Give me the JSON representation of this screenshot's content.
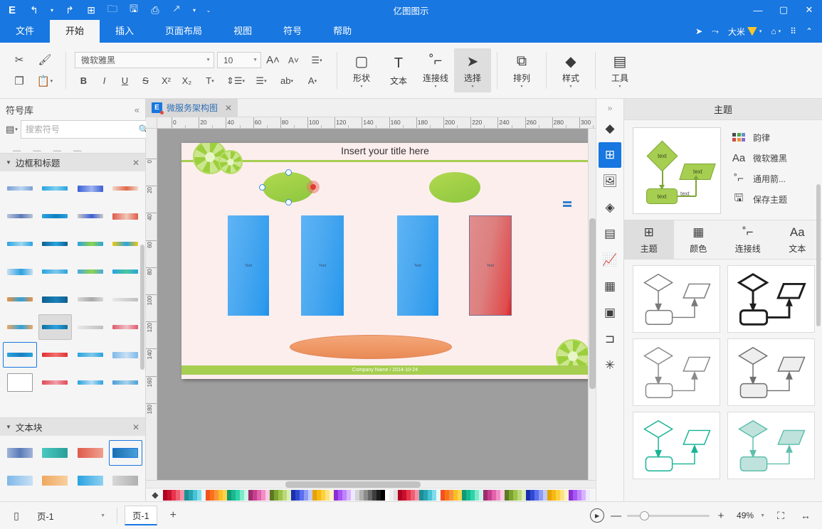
{
  "titlebar": {
    "app_title": "亿图图示",
    "logo": "E",
    "quick_access": [
      {
        "name": "undo-button",
        "glyph": "↰",
        "has_caret": true
      },
      {
        "name": "redo-button",
        "glyph": "↳",
        "has_caret": false
      },
      {
        "name": "new-button",
        "glyph": "⊞",
        "has_caret": false
      },
      {
        "name": "open-button",
        "glyph": "🗀",
        "has_caret": false
      },
      {
        "name": "save-button",
        "glyph": "🖫",
        "has_caret": false
      },
      {
        "name": "print-button",
        "glyph": "⎙",
        "has_caret": false
      },
      {
        "name": "export-button",
        "glyph": "⇱",
        "has_caret": true
      },
      {
        "name": "more-button",
        "glyph": "⌄",
        "has_caret": false
      }
    ],
    "window_controls": {
      "minimize": "—",
      "maximize": "▢",
      "close": "✕"
    }
  },
  "menubar": {
    "tabs": [
      {
        "label": "文件",
        "active": false
      },
      {
        "label": "开始",
        "active": true
      },
      {
        "label": "插入",
        "active": false
      },
      {
        "label": "页面布局",
        "active": false
      },
      {
        "label": "视图",
        "active": false
      },
      {
        "label": "符号",
        "active": false
      },
      {
        "label": "帮助",
        "active": false
      }
    ],
    "right_items": [
      {
        "name": "send-icon",
        "glyph": "➤",
        "label": ""
      },
      {
        "name": "share-icon",
        "glyph": "⤳",
        "label": ""
      },
      {
        "name": "user-account",
        "glyph": "",
        "label": "大米",
        "vip": true
      },
      {
        "name": "skin-icon",
        "glyph": "⌂",
        "label": ""
      },
      {
        "name": "apps-icon",
        "glyph": "⠿",
        "label": ""
      },
      {
        "name": "collapse-ribbon-icon",
        "glyph": "⌃",
        "label": ""
      }
    ]
  },
  "ribbon": {
    "clipboard": [
      {
        "name": "cut-button",
        "glyph": "✂"
      },
      {
        "name": "format-painter-button",
        "glyph": "🖌"
      },
      {
        "name": "copy-button",
        "glyph": "❐"
      },
      {
        "name": "paste-button",
        "glyph": "📋"
      }
    ],
    "font": {
      "family": "微软雅黑",
      "size": "10",
      "grow_label": "A",
      "shrink_label": "A"
    },
    "format_buttons": [
      {
        "name": "bold-button",
        "glyph": "B"
      },
      {
        "name": "italic-button",
        "glyph": "I"
      },
      {
        "name": "underline-button",
        "glyph": "U"
      },
      {
        "name": "strikethrough-button",
        "glyph": "S"
      },
      {
        "name": "superscript-button",
        "glyph": "X²"
      },
      {
        "name": "subscript-button",
        "glyph": "X₂"
      },
      {
        "name": "text-color-button",
        "glyph": "T"
      },
      {
        "name": "line-spacing-button",
        "glyph": "↕☰"
      },
      {
        "name": "bullet-list-button",
        "glyph": "☰"
      },
      {
        "name": "text-case-button",
        "glyph": "ab"
      },
      {
        "name": "clear-format-button",
        "glyph": "A"
      }
    ],
    "tools": [
      {
        "name": "shape-tool",
        "label": "形状",
        "glyph": "▢",
        "active": false,
        "caret": true
      },
      {
        "name": "text-tool",
        "label": "文本",
        "glyph": "T",
        "active": false,
        "caret": false
      },
      {
        "name": "connector-tool",
        "label": "连接线",
        "glyph": "⌐",
        "active": false,
        "caret": true
      },
      {
        "name": "select-tool",
        "label": "选择",
        "glyph": "➤",
        "active": true,
        "caret": true
      }
    ],
    "tools2": [
      {
        "name": "arrange-tool",
        "label": "排列",
        "glyph": "⧉",
        "active": false,
        "caret": true
      },
      {
        "name": "style-tool",
        "label": "样式",
        "glyph": "◆",
        "active": false,
        "caret": true
      },
      {
        "name": "utility-tool",
        "label": "工具",
        "glyph": "▤",
        "active": false,
        "caret": true
      }
    ]
  },
  "left_panel": {
    "title": "符号库",
    "collapse_glyph": "«",
    "search_placeholder": "搜索符号",
    "search_value": "",
    "search_icon": "🔍",
    "library_icon": "▤",
    "nav_up": "⌃",
    "nav_down": "⌄",
    "sections": [
      {
        "name": "section-borders-titles",
        "label": "边框和标题",
        "expanded": true
      },
      {
        "name": "section-text-blocks",
        "label": "文本块",
        "expanded": true
      }
    ]
  },
  "canvas": {
    "doc_tab": {
      "label": "微服务架构图",
      "close_glyph": "✕",
      "icon_letter": "E"
    },
    "ruler_ticks": [
      "0",
      "20",
      "40",
      "60",
      "80",
      "100",
      "120",
      "140",
      "160",
      "180",
      "200",
      "220",
      "240",
      "260",
      "280",
      "300"
    ],
    "vruler_ticks": [
      "0",
      "20",
      "40",
      "60",
      "80",
      "100",
      "120",
      "140",
      "160",
      "180"
    ],
    "page": {
      "title": "Insert your title here",
      "footer": "Company Name / 2014-10-24",
      "shapes": [
        {
          "name": "rect-1",
          "label": "Text",
          "color": "blue"
        },
        {
          "name": "rect-2",
          "label": "Text",
          "color": "blue"
        },
        {
          "name": "rect-3",
          "label": "Text",
          "color": "blue"
        },
        {
          "name": "rect-4",
          "label": "Text",
          "color": "red"
        }
      ]
    }
  },
  "vertical_bar": {
    "expand_glyph": "»",
    "icons": [
      {
        "name": "fill-icon",
        "glyph": "◆",
        "active": false
      },
      {
        "name": "theme-icon",
        "glyph": "⊞",
        "active": true
      },
      {
        "name": "image-icon",
        "glyph": "🖼",
        "active": false
      },
      {
        "name": "layers-icon",
        "glyph": "◈",
        "active": false
      },
      {
        "name": "document-icon",
        "glyph": "▤",
        "active": false
      },
      {
        "name": "chart-icon",
        "glyph": "📈",
        "active": false
      },
      {
        "name": "table-icon",
        "glyph": "▦",
        "active": false
      },
      {
        "name": "shape-data-icon",
        "glyph": "▣",
        "active": false
      },
      {
        "name": "container-icon",
        "glyph": "⊐",
        "active": false
      },
      {
        "name": "symbol-edit-icon",
        "glyph": "✳",
        "active": false
      }
    ]
  },
  "right_panel": {
    "title": "主题",
    "theme_options": [
      {
        "name": "theme-color-option",
        "label": "韵律",
        "icon": "color-grid-icon"
      },
      {
        "name": "theme-font-option",
        "label": "微软雅黑",
        "icon": "font-icon"
      },
      {
        "name": "theme-connector-option",
        "label": "通用箭...",
        "icon": "connector-icon"
      },
      {
        "name": "save-theme-option",
        "label": "保存主题",
        "icon": "save-icon"
      }
    ],
    "preview_labels": [
      "text",
      "text",
      "text",
      "text"
    ],
    "sub_tabs": [
      {
        "name": "tab-theme",
        "label": "主题",
        "glyph": "⊞",
        "active": true
      },
      {
        "name": "tab-color",
        "label": "颜色",
        "glyph": "▦",
        "active": false
      },
      {
        "name": "tab-connector",
        "label": "连接线",
        "glyph": "⌐",
        "active": false
      },
      {
        "name": "tab-text",
        "label": "文本",
        "glyph": "Aa",
        "active": false
      }
    ],
    "thumbnails": [
      {
        "name": "theme-thumb-1",
        "stroke": "#7a7a7a",
        "width": 1.5,
        "fill": "#ffffff"
      },
      {
        "name": "theme-thumb-2",
        "stroke": "#1e1e1e",
        "width": 3,
        "fill": "#ffffff"
      },
      {
        "name": "theme-thumb-3",
        "stroke": "#8a8a8a",
        "width": 1.5,
        "fill": "#ffffff"
      },
      {
        "name": "theme-thumb-4",
        "stroke": "#6e6e6e",
        "width": 1.5,
        "fill": "#eeeeee"
      },
      {
        "name": "theme-thumb-5",
        "stroke": "#16b396",
        "width": 1.5,
        "fill": "#ffffff"
      },
      {
        "name": "theme-thumb-6",
        "stroke": "#5fbfae",
        "width": 1.5,
        "fill": "#bfe3dc"
      }
    ]
  },
  "statusbar": {
    "view_icon": "▯",
    "page_selector": "页-1",
    "page_tab": "页-1",
    "add_page": "+",
    "play_glyph": "▶",
    "zoom_out": "—",
    "zoom_in": "+",
    "zoom_level": "49%",
    "fit_page_icon": "⛶",
    "fit_width_icon": "↔"
  },
  "colors": {
    "accent": "#1877e0",
    "ribbon_bg": "#f5f5f5",
    "canvas_bg": "#9e9e9e",
    "page_bg": "#fdeeee",
    "theme_green": "#a6ce51",
    "shape_blue": "#4aa8f0",
    "shape_red": "#e04b4b"
  },
  "palette": [
    "#b00020",
    "#c8102e",
    "#e8334a",
    "#ef5f74",
    "#f391a3",
    "#1a8f96",
    "#29a3b0",
    "#46c3d4",
    "#7fdcea",
    "#e8f6f9",
    "#f4511e",
    "#f97316",
    "#fb923c",
    "#fbbf24",
    "#fcd34d",
    "#0f9b74",
    "#18b890",
    "#2dd4a8",
    "#7fe8cb",
    "#c7f5e6",
    "#9d2d6e",
    "#c63f8f",
    "#e263ab",
    "#f08fc6",
    "#fbc8e2",
    "#5a7a22",
    "#7ba32e",
    "#9dc34a",
    "#bcd97a",
    "#dcecb8",
    "#1a2fb0",
    "#2f4ad0",
    "#5b6ef0",
    "#8c9bf5",
    "#c1c9fb",
    "#e8a200",
    "#f5b914",
    "#ffcf3d",
    "#ffe382",
    "#fff3c4",
    "#8b2fd4",
    "#a855f7",
    "#c084fc",
    "#d8b4fe",
    "#ede9fe",
    "#d4d4d4",
    "#b0b0b0",
    "#8c8c8c",
    "#666666",
    "#3d3d3d",
    "#1a1a1a",
    "#000000",
    "#ffffff",
    "#f0f0f0",
    "#e0e0e0"
  ]
}
